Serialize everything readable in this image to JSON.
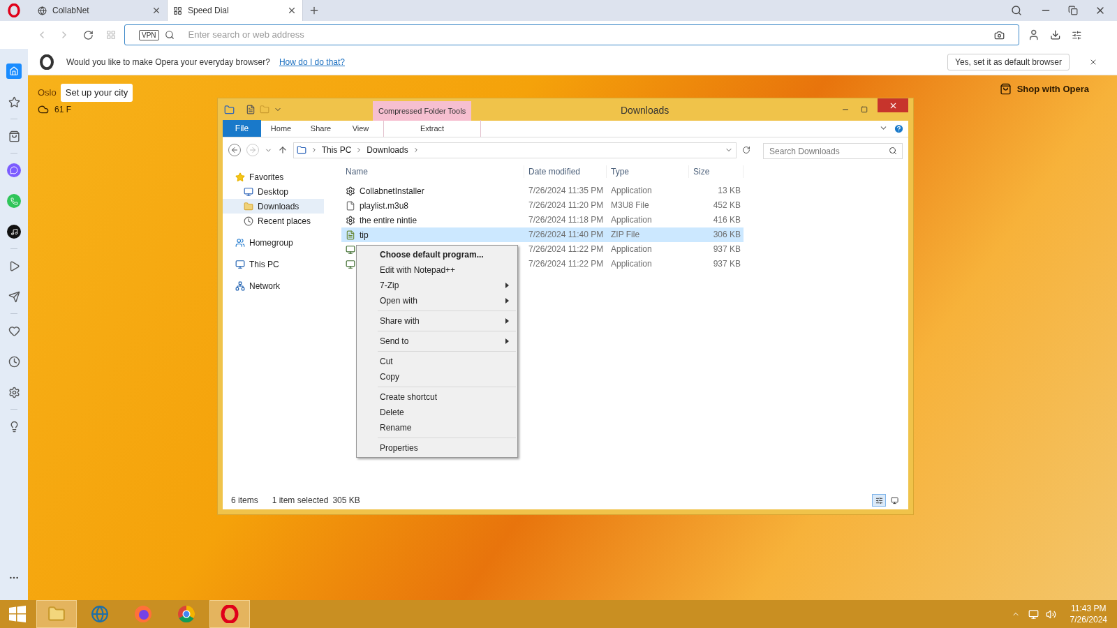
{
  "browser": {
    "tabs": [
      {
        "title": "CollabNet",
        "selected": false
      },
      {
        "title": "Speed Dial",
        "selected": true
      }
    ],
    "address_bar": {
      "vpn_badge": "VPN",
      "placeholder": "Enter search or web address"
    },
    "default_prompt": {
      "message": "Would you like to make Opera your everyday browser?",
      "link": "How do I do that?",
      "button": "Yes, set it as default browser"
    }
  },
  "speed_dial": {
    "weather": {
      "city": "Oslo",
      "tooltip": "Set up your city",
      "temperature": "61 F"
    },
    "shop_button": "Shop with Opera"
  },
  "explorer": {
    "title": "Downloads",
    "context_tab": "Compressed Folder Tools",
    "ribbon_tabs": [
      {
        "label": "File",
        "kind": "file"
      },
      {
        "label": "Home",
        "kind": "tab"
      },
      {
        "label": "Share",
        "kind": "tab"
      },
      {
        "label": "View",
        "kind": "tab"
      },
      {
        "label": "Extract",
        "kind": "context"
      }
    ],
    "breadcrumb": [
      "This PC",
      "Downloads"
    ],
    "search_placeholder": "Search Downloads",
    "nav_pane": [
      {
        "label": "Favorites",
        "kind": "star",
        "selected": false,
        "children": [
          {
            "label": "Desktop",
            "kind": "desktop",
            "selected": false
          },
          {
            "label": "Downloads",
            "kind": "downloads",
            "selected": true
          },
          {
            "label": "Recent places",
            "kind": "recent",
            "selected": false
          }
        ]
      },
      {
        "label": "Homegroup",
        "kind": "homegroup",
        "selected": false
      },
      {
        "label": "This PC",
        "kind": "pc",
        "selected": false
      },
      {
        "label": "Network",
        "kind": "network",
        "selected": false
      }
    ],
    "columns": [
      "Name",
      "Date modified",
      "Type",
      "Size"
    ],
    "files": [
      {
        "name": "CollabnetInstaller",
        "date": "7/26/2024 11:35 PM",
        "type": "Application",
        "size": "13 KB",
        "kind": "app",
        "selected": false
      },
      {
        "name": "playlist.m3u8",
        "date": "7/26/2024 11:20 PM",
        "type": "M3U8 File",
        "size": "452 KB",
        "kind": "file",
        "selected": false
      },
      {
        "name": "the entire nintie",
        "date": "7/26/2024 11:18 PM",
        "type": "Application",
        "size": "416 KB",
        "kind": "app",
        "selected": false
      },
      {
        "name": "tip",
        "date": "7/26/2024 11:40 PM",
        "type": "ZIP File",
        "size": "306 KB",
        "kind": "zip",
        "selected": true
      },
      {
        "date": "7/26/2024 11:22 PM",
        "type": "Application",
        "size": "937 KB",
        "kind": "installer",
        "selected": false
      },
      {
        "date": "7/26/2024 11:22 PM",
        "type": "Application",
        "size": "937 KB",
        "kind": "installer",
        "selected": false
      }
    ],
    "status": {
      "count": "6 items",
      "selection": "1 item selected",
      "selection_size": "305 KB"
    }
  },
  "context_menu": [
    {
      "kind": "item",
      "label": "Choose default program...",
      "bold": true,
      "submenu": false
    },
    {
      "kind": "item",
      "label": "Edit with Notepad++",
      "bold": false,
      "submenu": false
    },
    {
      "kind": "item",
      "label": "7-Zip",
      "bold": false,
      "submenu": true
    },
    {
      "kind": "item",
      "label": "Open with",
      "bold": false,
      "submenu": true
    },
    {
      "kind": "separator"
    },
    {
      "kind": "item",
      "label": "Share with",
      "bold": false,
      "submenu": true
    },
    {
      "kind": "separator"
    },
    {
      "kind": "item",
      "label": "Send to",
      "bold": false,
      "submenu": true
    },
    {
      "kind": "separator"
    },
    {
      "kind": "item",
      "label": "Cut",
      "bold": false,
      "submenu": false
    },
    {
      "kind": "item",
      "label": "Copy",
      "bold": false,
      "submenu": false
    },
    {
      "kind": "separator"
    },
    {
      "kind": "item",
      "label": "Create shortcut",
      "bold": false,
      "submenu": false
    },
    {
      "kind": "item",
      "label": "Delete",
      "bold": false,
      "submenu": false
    },
    {
      "kind": "item",
      "label": "Rename",
      "bold": false,
      "submenu": false
    },
    {
      "kind": "separator"
    },
    {
      "kind": "item",
      "label": "Properties",
      "bold": false,
      "submenu": false
    }
  ],
  "taskbar": {
    "apps": [
      {
        "kind": "explorer",
        "selected": true
      },
      {
        "kind": "globe",
        "selected": false
      },
      {
        "kind": "firefox",
        "selected": false
      },
      {
        "kind": "chrome",
        "selected": false
      },
      {
        "kind": "opera",
        "selected": true
      }
    ],
    "time": "11:43 PM",
    "date": "7/26/2024"
  }
}
